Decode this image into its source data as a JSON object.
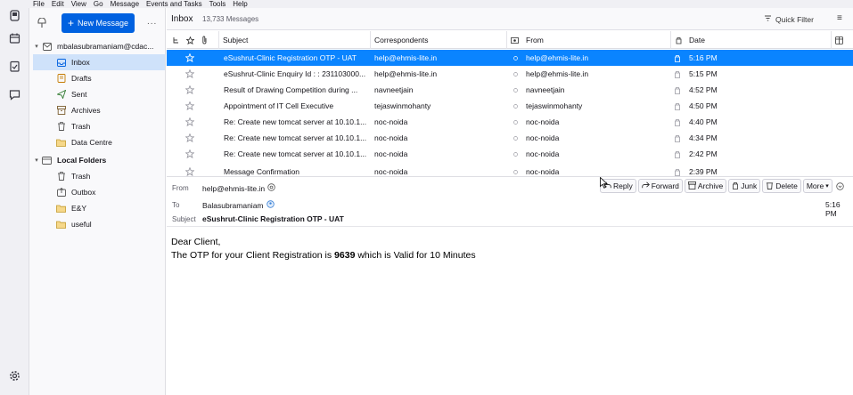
{
  "menubar": [
    "File",
    "Edit",
    "View",
    "Go",
    "Message",
    "Events and Tasks",
    "Tools",
    "Help"
  ],
  "spaces": {
    "icons": [
      "mail-icon",
      "address-book-icon",
      "calendar-icon",
      "tasks-icon",
      "chat-icon"
    ],
    "settings_icon": "gear-icon"
  },
  "folder_pane": {
    "new_message_label": "New Message",
    "more_label": "...",
    "account": "mbalasubramaniam@cdac...",
    "folders": [
      {
        "name": "Inbox",
        "icon": "inbox-icon",
        "selected": true
      },
      {
        "name": "Drafts",
        "icon": "drafts-icon"
      },
      {
        "name": "Sent",
        "icon": "sent-icon"
      },
      {
        "name": "Archives",
        "icon": "archive-icon"
      },
      {
        "name": "Trash",
        "icon": "trash-icon"
      },
      {
        "name": "Data Centre",
        "icon": "folder-icon"
      }
    ],
    "local_folders_label": "Local Folders",
    "local_folders": [
      {
        "name": "Trash",
        "icon": "trash-icon"
      },
      {
        "name": "Outbox",
        "icon": "outbox-icon"
      },
      {
        "name": "E&Y",
        "icon": "folder-icon"
      },
      {
        "name": "useful",
        "icon": "folder-icon"
      }
    ]
  },
  "thread_pane": {
    "title": "Inbox",
    "count": "13,733 Messages",
    "quick_filter": "Quick Filter",
    "columns": {
      "subject": "Subject",
      "correspondents": "Correspondents",
      "from": "From",
      "date": "Date"
    },
    "rows": [
      {
        "subject": "eSushrut-Clinic Registration OTP - UAT",
        "correspondents": "help@ehmis-lite.in",
        "from": "help@ehmis-lite.in",
        "date": "5:16 PM",
        "selected": true
      },
      {
        "subject": "eSushrut-Clinic Enquiry Id : : 231103000...",
        "correspondents": "help@ehmis-lite.in",
        "from": "help@ehmis-lite.in",
        "date": "5:15 PM"
      },
      {
        "subject": "Result of Drawing Competition during ...",
        "correspondents": "navneetjain",
        "from": "navneetjain",
        "date": "4:52 PM"
      },
      {
        "subject": "Appointment of IT Cell Executive",
        "correspondents": "tejaswinmohanty",
        "from": "tejaswinmohanty",
        "date": "4:50 PM"
      },
      {
        "subject": "Re: Create new tomcat server at 10.10.1...",
        "correspondents": "noc-noida",
        "from": "noc-noida",
        "date": "4:40 PM"
      },
      {
        "subject": "Re: Create new tomcat server at 10.10.1...",
        "correspondents": "noc-noida",
        "from": "noc-noida",
        "date": "4:34 PM"
      },
      {
        "subject": "Re: Create new tomcat server at 10.10.1...",
        "correspondents": "noc-noida",
        "from": "noc-noida",
        "date": "2:42 PM"
      },
      {
        "subject": "Message Confirmation",
        "correspondents": "noc-noida",
        "from": "noc-noida",
        "date": "2:39 PM"
      }
    ]
  },
  "message": {
    "from_label": "From",
    "from_value": "help@ehmis-lite.in",
    "to_label": "To",
    "to_value": "Balasubramaniam",
    "subject_label": "Subject",
    "subject_value": "eSushrut-Clinic Registration OTP - UAT",
    "time": "5:16 PM",
    "actions": {
      "reply": "Reply",
      "forward": "Forward",
      "archive": "Archive",
      "junk": "Junk",
      "delete": "Delete",
      "more": "More"
    },
    "body": {
      "greeting": "Dear Client,",
      "line_prefix": "The OTP for your Client Registration is ",
      "otp": "9639",
      "line_suffix": " which is Valid for 10 Minutes"
    }
  },
  "colors": {
    "accent": "#0061e0",
    "selected_row": "#0a84ff",
    "selected_folder": "#cfe2fa"
  }
}
